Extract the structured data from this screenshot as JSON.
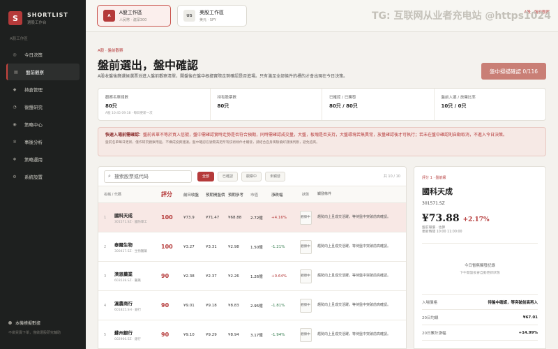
{
  "brand": {
    "logo": "S",
    "name": "SHORTLIST",
    "sub": "選股工作台"
  },
  "sidebar": {
    "section": "A股工作區",
    "items": [
      {
        "label": "今日決策",
        "icon": "circle-icon"
      },
      {
        "label": "盤前觀察",
        "icon": "list-icon"
      },
      {
        "label": "持倉管理",
        "icon": "diamond-icon"
      },
      {
        "label": "復盤研究",
        "icon": "chart-icon"
      },
      {
        "label": "策略中心",
        "icon": "target-icon"
      },
      {
        "label": "事後分析",
        "icon": "gear-icon"
      },
      {
        "label": "策略運用",
        "icon": "layers-icon"
      },
      {
        "label": "系統設置",
        "icon": "settings-icon"
      }
    ],
    "footer_title": "本機模擬數據",
    "footer_sub": "不做買賣下單，僅做選股研究輔助"
  },
  "workspaces": [
    {
      "badge": "A",
      "title": "A股工作區",
      "sub": "人民幣 · 滬深300"
    },
    {
      "badge": "US",
      "title": "美股工作區",
      "sub": "美元 · SPY"
    }
  ],
  "watermark": "TG: 互联网从业者充电站 @https1024",
  "top_tag": "A股 · 盤前觀察",
  "header": {
    "crumb": "A股 · 盤前觀察",
    "title": "盤前選出，盤中確認",
    "desc": "A股收盤後篩選候選票池進入盤前觀察清單，開盤後在盤中根據實際走勢確認是否進場。只有滿足全部條件的標的才會出現在今日決策。",
    "scan_button": "盤中掃描確認 0/116"
  },
  "stats": [
    {
      "label": "觀察名單總數",
      "value": "80只",
      "note": "A股 10:45 09:18 · 每日更新一次"
    },
    {
      "label": "持有股票數",
      "value": "80只",
      "note": ""
    },
    {
      "label": "已確認 / 已觸發",
      "value": "80只 / 80只",
      "note": ""
    },
    {
      "label": "盤前入選 / 放棄比率",
      "value": "10只 / 0只",
      "note": ""
    }
  ],
  "alert": {
    "lead": "快速入場前需確認：",
    "line1": "盤前名單不等於買入信號，盤中需確認實時走勢是否符合預期，同時需確認成交量，大盤，板塊是否支持，大盤環境若無異常，放量確認後才可執行；若未在盤中確認則自動取消，不進入今日決策。",
    "line2": "盤前名單每日更新，僅作研究觀察用途，不構成投資建議。盤中確認信號需滿足所有技術條件才觸發，請結合自身風險偏好謹慎判斷，避免追高。"
  },
  "table": {
    "search_placeholder": "搜索股票或代码",
    "filters": [
      "全部",
      "已確認",
      "觀察中",
      "未觸發"
    ],
    "count": "共 10 / 10",
    "columns": [
      "名稱 / 代碼",
      "評分",
      "前日收盤",
      "預期開盤價",
      "預期參考",
      "市值",
      "漲跌幅",
      "狀態",
      "觸發條件"
    ],
    "rows": [
      {
        "rank": "1",
        "name": "國科天成",
        "code": "301571.SZ · 國防軍工",
        "score": "100",
        "close": "¥73.9",
        "open": "¥71.47",
        "ref": "¥68.88",
        "cap": "2.72億",
        "chg": "+4.16%",
        "dir": "up",
        "status": "觀察中",
        "note": "趨勢向上且成交活躍，等待盤中突破前高確認。"
      },
      {
        "rank": "2",
        "name": "泰爾生物",
        "code": "300417.SZ · 生物醫藥",
        "score": "100",
        "close": "¥3.27",
        "open": "¥3.31",
        "ref": "¥2.98",
        "cap": "1.50億",
        "chg": "-1.21%",
        "dir": "down",
        "status": "觀察中",
        "note": "趨勢向上且成交活躍，等待盤中突破前高確認。"
      },
      {
        "rank": "3",
        "name": "濟恩藥業",
        "code": "603538.SZ · 醫藥",
        "score": "90",
        "close": "¥2.38",
        "open": "¥2.37",
        "ref": "¥2.26",
        "cap": "1.26億",
        "chg": "+0.64%",
        "dir": "up",
        "status": "觀察中",
        "note": "趨勢向上且成交活躍，等待盤中突破前高確認。"
      },
      {
        "rank": "4",
        "name": "滬農商行",
        "code": "601825.SH · 銀行",
        "score": "90",
        "close": "¥9.01",
        "open": "¥9.18",
        "ref": "¥8.83",
        "cap": "2.95億",
        "chg": "-1.81%",
        "dir": "down",
        "status": "觀察中",
        "note": "趨勢向上且成交活躍，等待盤中突破前高確認。"
      },
      {
        "rank": "5",
        "name": "蘇州銀行",
        "code": "002966.SZ · 銀行",
        "score": "90",
        "close": "¥9.10",
        "open": "¥9.29",
        "ref": "¥8.94",
        "cap": "3.17億",
        "chg": "-1.94%",
        "dir": "down",
        "status": "觀察中",
        "note": "趨勢向上且成交活躍，等待盤中突破前高確認。"
      }
    ]
  },
  "detail": {
    "tag": "評分 1 · 盤前級",
    "name": "國科天成",
    "code": "301571.SZ",
    "price": "¥73.88",
    "change": "+2.17%",
    "meta1": "盤前報價 · 估算",
    "meta2": "更新時間 10:00 11:00:00",
    "empty_title": "今日暫無觸發記錄",
    "empty_sub": "下午開盤後會自動更新狀態",
    "kv": [
      {
        "k": "入場價格",
        "v": "待盤中確認，等突破前高再入"
      },
      {
        "k": "20日均線",
        "v": "¥67.01"
      },
      {
        "k": "20日累計漲幅",
        "v": "+14.99%"
      }
    ]
  },
  "colors": {
    "accent": "#b53a3a",
    "sidebar_bg": "#1e201f",
    "up": "#b53a3a",
    "down": "#2f7a4a"
  }
}
